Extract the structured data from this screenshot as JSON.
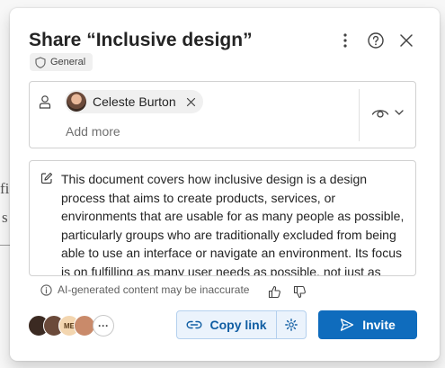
{
  "dialog": {
    "title": "Share “Inclusive design”",
    "sensitivity_label": "General",
    "more_options_icon": "more-vertical-icon",
    "help_icon": "question-circle-icon",
    "close_icon": "close-icon"
  },
  "recipients": {
    "people": [
      {
        "name": "Celeste Burton"
      }
    ],
    "add_placeholder": "Add more",
    "permission_icon": "eye-icon"
  },
  "message": {
    "text": "This document covers how inclusive design is a design process that aims to create products, services, or environments that are usable for as many people as possible, particularly groups who are traditionally excluded from being able to use an interface or navigate an environment. Its focus is on fulfilling as many user needs as possible, not just as"
  },
  "ai_notice": {
    "text": "AI-generated content may be inaccurate"
  },
  "shared_with": {
    "avatars": [
      {
        "initials": "",
        "color": "#3b2a22"
      },
      {
        "initials": "",
        "color": "#6b4a3a"
      },
      {
        "initials": "ME",
        "color": "#f3d6b0"
      },
      {
        "initials": "",
        "color": "#c98a6a"
      }
    ],
    "more_label": "···"
  },
  "actions": {
    "copy_link_label": "Copy link",
    "invite_label": "Invite"
  },
  "colors": {
    "primary": "#0f6cbd",
    "copy_bg": "#ebf3fc",
    "copy_text": "#115ea3"
  }
}
